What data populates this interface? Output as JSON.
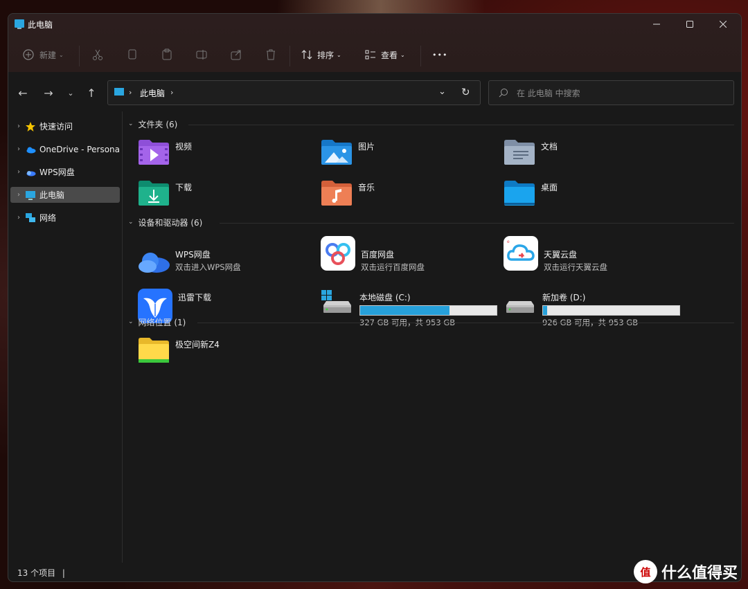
{
  "window": {
    "title": "此电脑"
  },
  "toolbar": {
    "new_label": "新建",
    "sort_label": "排序",
    "view_label": "查看",
    "more_label": "•••"
  },
  "address": {
    "location": "此电脑"
  },
  "search": {
    "placeholder": "在 此电脑 中搜索"
  },
  "sidebar": {
    "items": [
      {
        "label": "快速访问"
      },
      {
        "label": "OneDrive - Persona"
      },
      {
        "label": "WPS网盘"
      },
      {
        "label": "此电脑"
      },
      {
        "label": "网络"
      }
    ]
  },
  "groups": {
    "folders": {
      "header": "文件夹 (6)",
      "items": [
        {
          "label": "视频"
        },
        {
          "label": "图片"
        },
        {
          "label": "文档"
        },
        {
          "label": "下载"
        },
        {
          "label": "音乐"
        },
        {
          "label": "桌面"
        }
      ]
    },
    "devices": {
      "header": "设备和驱动器 (6)",
      "items": [
        {
          "label": "WPS网盘",
          "sub": "双击进入WPS网盘"
        },
        {
          "label": "百度网盘",
          "sub": "双击运行百度网盘"
        },
        {
          "label": "天翼云盘",
          "sub": "双击运行天翼云盘"
        },
        {
          "label": "迅雷下载"
        },
        {
          "label": "本地磁盘 (C:)",
          "sub": "327 GB 可用，共 953 GB",
          "used_fraction": 0.657
        },
        {
          "label": "新加卷 (D:)",
          "sub": "926 GB 可用，共 953 GB",
          "used_fraction": 0.028
        }
      ]
    },
    "network": {
      "header": "网络位置 (1)",
      "items": [
        {
          "label": "极空间新Z4"
        }
      ]
    }
  },
  "status": {
    "count": "13 个项目",
    "cursor": "|"
  },
  "watermark": {
    "logo": "值",
    "text": "什么值得买"
  },
  "colors": {
    "accent": "#26a0da",
    "window_bg": "#191919"
  }
}
